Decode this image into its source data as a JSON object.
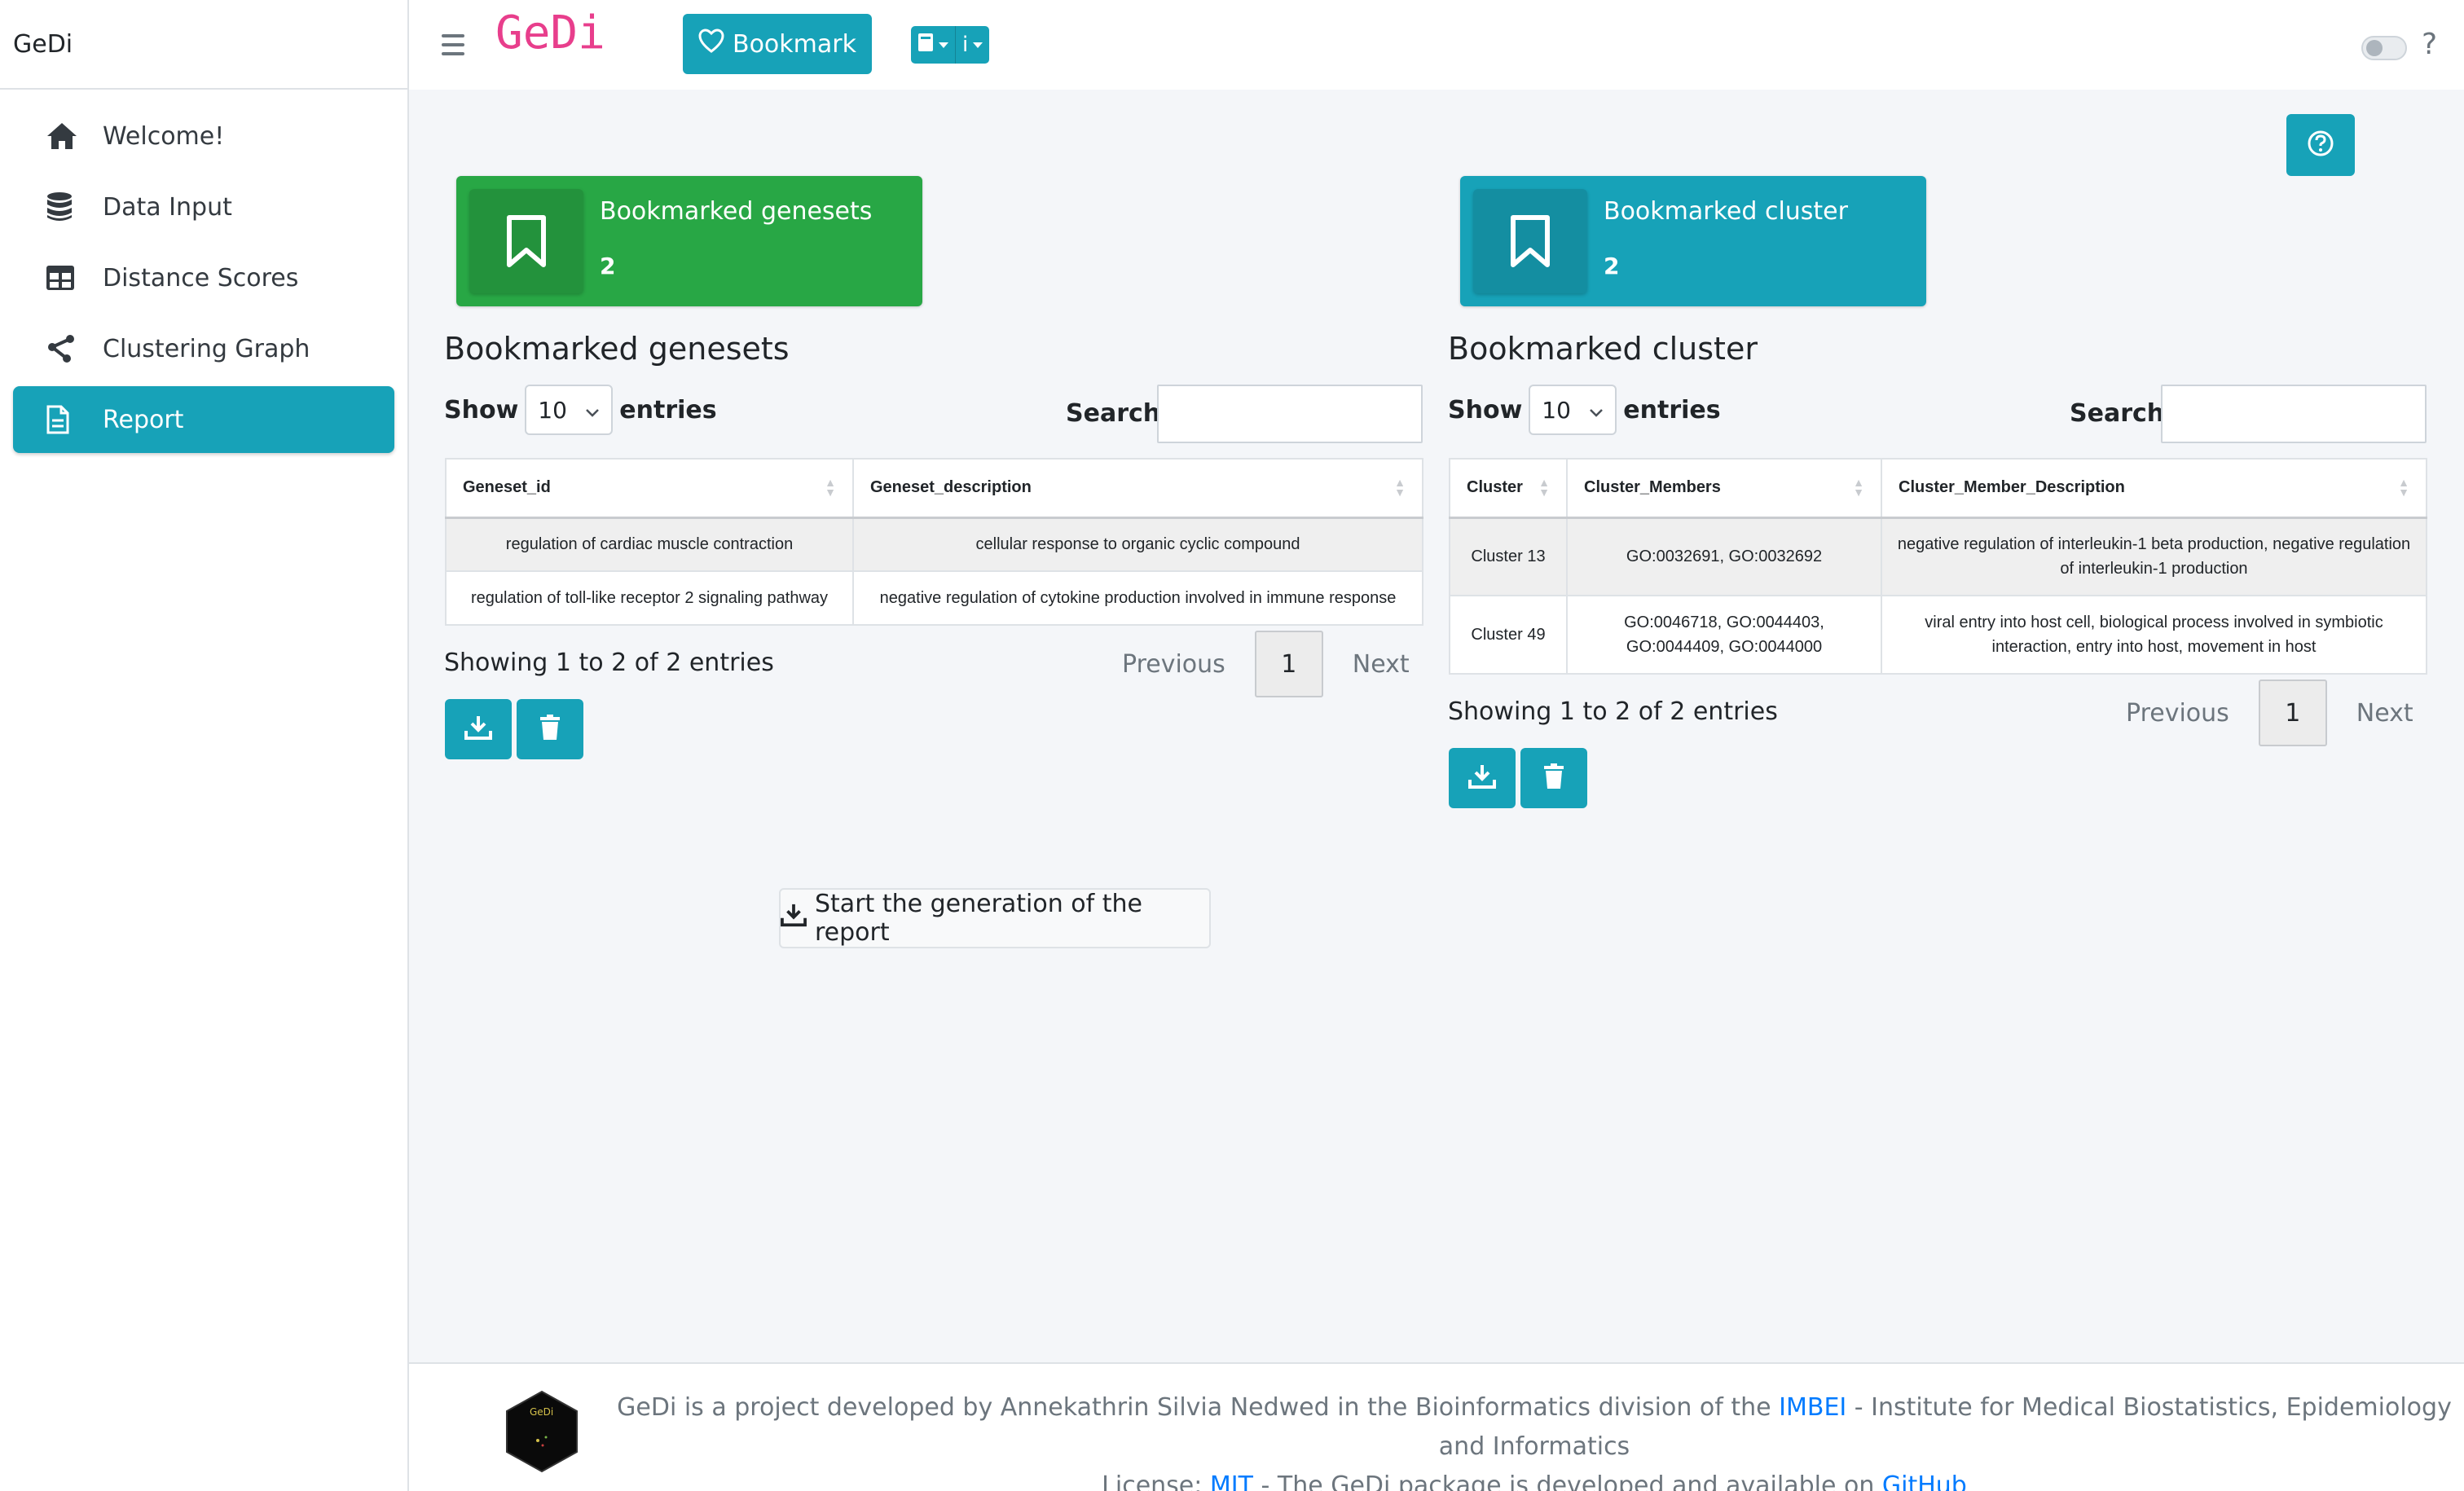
{
  "app": {
    "name": "GeDi",
    "logo_text": "GeDi"
  },
  "sidebar": {
    "items": [
      {
        "label": "Welcome!",
        "icon": "home-icon"
      },
      {
        "label": "Data Input",
        "icon": "database-icon"
      },
      {
        "label": "Distance Scores",
        "icon": "table-icon"
      },
      {
        "label": "Clustering Graph",
        "icon": "share-nodes-icon"
      },
      {
        "label": "Report",
        "icon": "file-icon",
        "active": true
      }
    ]
  },
  "topbar": {
    "bookmark_label": "Bookmark",
    "info_label": "i",
    "help": "?"
  },
  "genesets_box": {
    "title": "Bookmarked genesets",
    "count": "2",
    "color": "#28a745"
  },
  "cluster_box": {
    "title": "Bookmarked cluster",
    "count": "2",
    "color": "#17a2b8"
  },
  "genesets_table": {
    "title": "Bookmarked genesets",
    "show": "Show",
    "entries_value": "10",
    "entries": "entries",
    "search_label": "Search:",
    "columns": [
      "Geneset_id",
      "Geneset_description"
    ],
    "rows": [
      [
        "regulation of cardiac muscle contraction",
        "cellular response to organic cyclic compound"
      ],
      [
        "regulation of toll-like receptor 2 signaling pathway",
        "negative regulation of cytokine production involved in immune response"
      ]
    ],
    "info": "Showing 1 to 2 of 2 entries",
    "previous": "Previous",
    "page": "1",
    "next": "Next"
  },
  "cluster_table": {
    "title": "Bookmarked cluster",
    "show": "Show",
    "entries_value": "10",
    "entries": "entries",
    "search_label": "Search:",
    "columns": [
      "Cluster",
      "Cluster_Members",
      "Cluster_Member_Description"
    ],
    "rows": [
      [
        "Cluster 13",
        "GO:0032691, GO:0032692",
        "negative regulation of interleukin-1 beta production, negative regulation of interleukin-1 production"
      ],
      [
        "Cluster 49",
        "GO:0046718, GO:0044403, GO:0044409, GO:0044000",
        "viral entry into host cell, biological process involved in symbiotic interaction, entry into host, movement in host"
      ]
    ],
    "info": "Showing 1 to 2 of 2 entries",
    "previous": "Previous",
    "page": "1",
    "next": "Next"
  },
  "report_button": "Start the generation of the report",
  "footer": {
    "logo_text": "GeDi",
    "line1_pre": "GeDi is a project developed by Annekathrin Silvia Nedwed in the Bioinformatics division of the ",
    "line1_link": "IMBEI",
    "line1_post": " - Institute for Medical Biostatistics, Epidemiology and Informatics",
    "line2_pre": "License: ",
    "line2_link1": "MIT",
    "line2_mid": " - The GeDi package is developed and available on ",
    "line2_link2": "GitHub"
  }
}
